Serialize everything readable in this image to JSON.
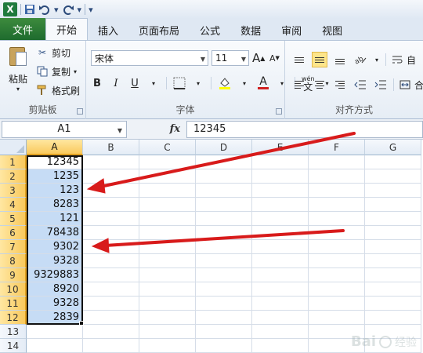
{
  "qat": {
    "logo": "X",
    "save_icon": "save-icon",
    "undo_icon": "undo-icon",
    "redo_icon": "redo-icon"
  },
  "tabs": {
    "file": "文件",
    "items": [
      "开始",
      "插入",
      "页面布局",
      "公式",
      "数据",
      "审阅",
      "视图"
    ],
    "active_index": 0
  },
  "ribbon": {
    "clipboard": {
      "paste": "粘贴",
      "cut": "剪切",
      "copy": "复制",
      "format_painter": "格式刷",
      "label": "剪贴板"
    },
    "font": {
      "name": "宋体",
      "size": "11",
      "grow": "A",
      "shrink": "A",
      "bold": "B",
      "italic": "I",
      "underline": "U",
      "color_glyph": "A",
      "phonetic": "wén",
      "phonetic_char": "文",
      "label": "字体",
      "fill_color": "#ffff00",
      "font_color": "#d02020"
    },
    "alignment": {
      "label": "对齐方式",
      "wrap": "自",
      "merge": "合"
    }
  },
  "formula_bar": {
    "name_box": "A1",
    "fx": "fx",
    "value": "12345"
  },
  "grid": {
    "columns": [
      "A",
      "B",
      "C",
      "D",
      "E",
      "F",
      "G"
    ],
    "selected_column": "A",
    "rows": [
      {
        "n": "1",
        "a": "12345"
      },
      {
        "n": "2",
        "a": "1235"
      },
      {
        "n": "3",
        "a": "123"
      },
      {
        "n": "4",
        "a": "8283"
      },
      {
        "n": "5",
        "a": "121"
      },
      {
        "n": "6",
        "a": "78438"
      },
      {
        "n": "7",
        "a": "9302"
      },
      {
        "n": "8",
        "a": "9328"
      },
      {
        "n": "9",
        "a": "9329883"
      },
      {
        "n": "10",
        "a": "8920"
      },
      {
        "n": "11",
        "a": "9328"
      },
      {
        "n": "12",
        "a": "2839"
      },
      {
        "n": "13",
        "a": ""
      },
      {
        "n": "14",
        "a": ""
      }
    ],
    "selected_rows": 12
  },
  "annotations": {
    "arrow_color": "#d81b1b"
  },
  "watermark": {
    "text": "Bai",
    "suffix": "经验"
  }
}
